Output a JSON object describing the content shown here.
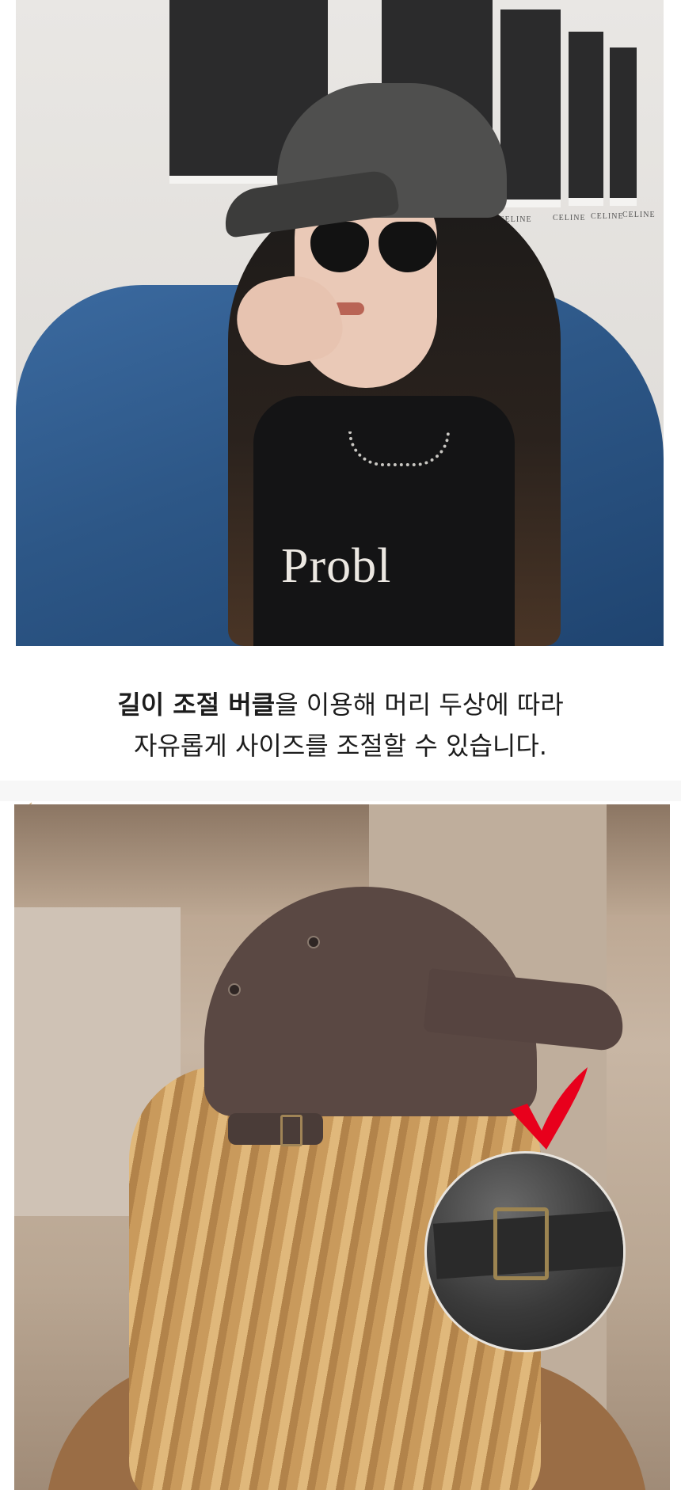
{
  "top_photo": {
    "shirt_text": "Probl",
    "gallery_captions": [
      "CELINE",
      "CELINE",
      "CELINE",
      "CELINE"
    ]
  },
  "description": {
    "line1_bold": "길이 조절 버클",
    "line1_rest": "을 이용해 머리 두상에 따라",
    "line2": "자유롭게 사이즈를 조절할 수 있습니다."
  },
  "bottom_photo": {
    "highlight": "check-mark",
    "highlight_color": "#e8001c",
    "detail": "buckle-closeup"
  },
  "colors": {
    "text": "#1c1c1c",
    "accent_red": "#e8001c"
  }
}
